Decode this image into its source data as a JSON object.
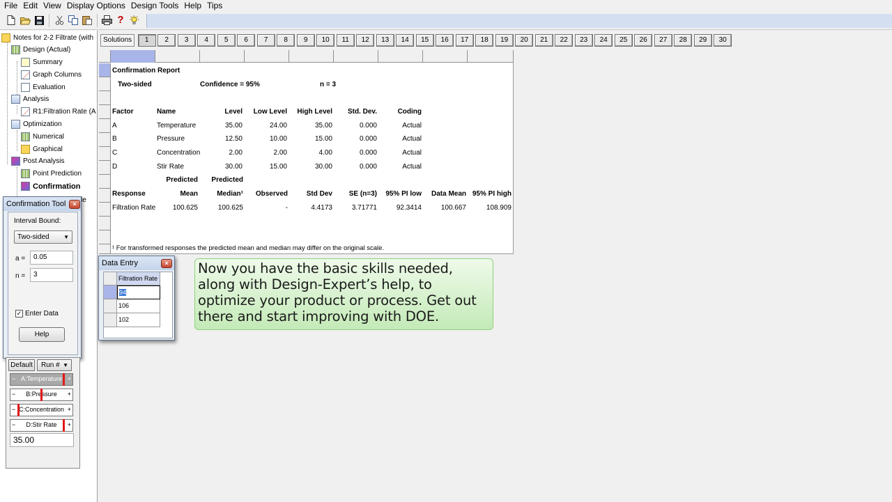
{
  "menu": [
    "File",
    "Edit",
    "View",
    "Display Options",
    "Design Tools",
    "Help",
    "Tips"
  ],
  "toolbar_icons": [
    "new-file-icon",
    "open-folder-icon",
    "save-icon",
    "cut-icon",
    "copy-icon",
    "paste-icon",
    "print-icon",
    "help-question-icon",
    "tip-lightbulb-icon"
  ],
  "tree": {
    "root": "Notes for 2-2 Filtrate (with",
    "items": [
      {
        "label": "Design (Actual)"
      },
      {
        "label": "Summary"
      },
      {
        "label": "Graph Columns"
      },
      {
        "label": "Evaluation"
      },
      {
        "label": "Analysis"
      },
      {
        "label": "R1:Filtration Rate (A"
      },
      {
        "label": "Optimization"
      },
      {
        "label": "Numerical"
      },
      {
        "label": "Graphical"
      },
      {
        "label": "Post Analysis"
      },
      {
        "label": "Point Prediction"
      },
      {
        "label": "Confirmation"
      },
      {
        "label": "le"
      }
    ]
  },
  "solutions": {
    "label": "Solutions",
    "tabs": [
      "1",
      "2",
      "3",
      "4",
      "5",
      "6",
      "7",
      "8",
      "9",
      "10",
      "11",
      "12",
      "13",
      "14",
      "15",
      "16",
      "17",
      "18",
      "19",
      "20",
      "21",
      "22",
      "23",
      "24",
      "25",
      "26",
      "27",
      "28",
      "29",
      "30"
    ]
  },
  "report": {
    "title": "Confirmation Report",
    "sided": "Two-sided",
    "confidence": "Confidence = 95%",
    "n": "n =  3",
    "factor_headers": [
      "Factor",
      "Name",
      "Level",
      "Low Level",
      "High Level",
      "Std. Dev.",
      "Coding"
    ],
    "factors": [
      [
        "A",
        "Temperature",
        "35.00",
        "24.00",
        "35.00",
        "0.000",
        "Actual"
      ],
      [
        "B",
        "Pressure",
        "12.50",
        "10.00",
        "15.00",
        "0.000",
        "Actual"
      ],
      [
        "C",
        "Concentration",
        "2.00",
        "2.00",
        "4.00",
        "0.000",
        "Actual"
      ],
      [
        "D",
        "Stir Rate",
        "30.00",
        "15.00",
        "30.00",
        "0.000",
        "Actual"
      ]
    ],
    "predicted_headers": [
      "Predicted",
      "Predicted"
    ],
    "response_headers": [
      "Response",
      "Mean",
      "Median¹",
      "Observed",
      "Std Dev",
      "SE (n=3)",
      "95% PI low",
      "Data Mean",
      "95% PI high"
    ],
    "response_row": [
      "Filtration Rate",
      "100.625",
      "100.625",
      "-",
      "4.4173",
      "3.71771",
      "92.3414",
      "100.667",
      "108.909"
    ],
    "footnote": "¹ For transformed responses the predicted mean and median may differ on the original scale."
  },
  "confirmation_tool": {
    "title": "Confirmation Tool",
    "interval_label": "Interval Bound:",
    "interval_value": "Two-sided",
    "alpha_label": "a =",
    "alpha_value": "0.05",
    "n_label": "n =",
    "n_value": "3",
    "enter_data_label": "Enter Data",
    "enter_data_checked": true,
    "help_label": "Help"
  },
  "factor_tool": {
    "default_label": "Default",
    "run_label": "Run #",
    "factors": [
      {
        "label": "A:Temperature",
        "level": 1.0
      },
      {
        "label": "B:Pressure",
        "level": 0.5
      },
      {
        "label": "C:Concentration",
        "level": 0.0
      },
      {
        "label": "D:Stir Rate",
        "level": 1.0
      }
    ],
    "minus": "−",
    "plus": "+",
    "value": "35.00"
  },
  "data_entry": {
    "title": "Data Entry",
    "column": "Filtration Rate",
    "rows": [
      "94",
      "106",
      "102"
    ]
  },
  "callout": {
    "text": "Now you have the basic skills needed, along with Design-Expert’s help, to optimize your product or process.  Get out there and start improving with DOE."
  },
  "colors": {
    "selection": "#a9b5e9",
    "callout_bg": "#d6f2cc",
    "slider_marker": "#e01818"
  }
}
